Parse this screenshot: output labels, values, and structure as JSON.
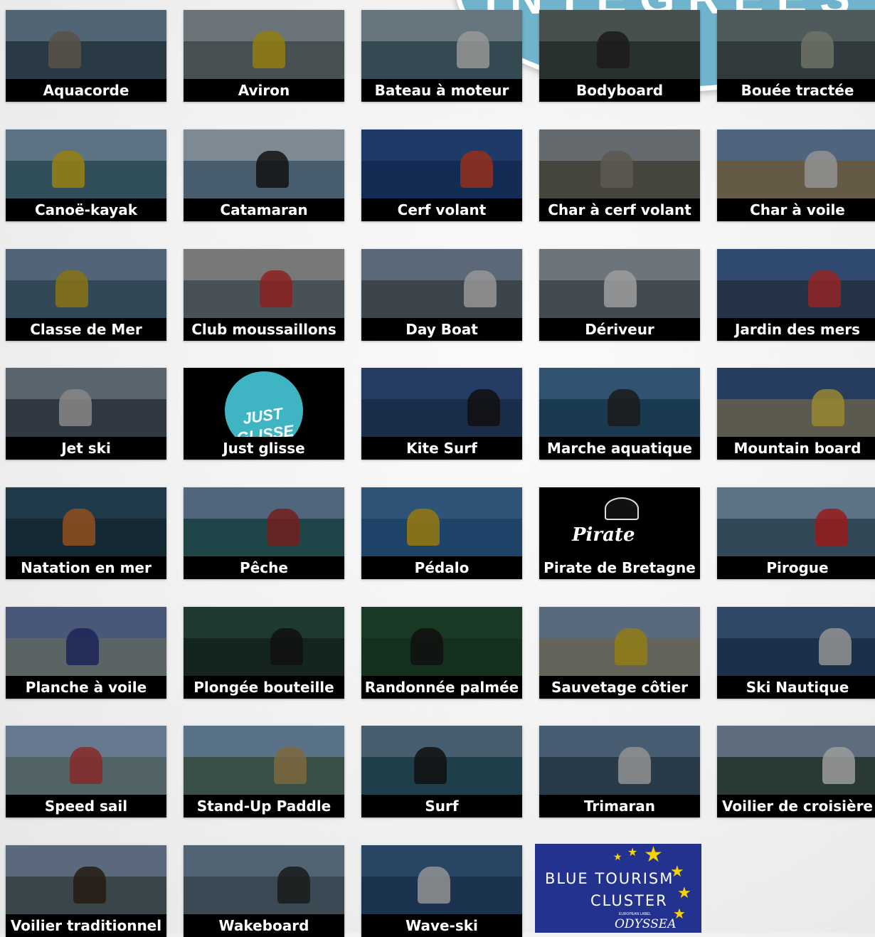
{
  "header": {
    "badge_text": "INTÉGRÉES"
  },
  "activities": [
    {
      "label": "Aquacorde",
      "sky": "#7f9bb3",
      "sea": "#3f5a6a",
      "accent": "#8a7f70"
    },
    {
      "label": "Aviron",
      "sky": "#a5b2b8",
      "sea": "#6d7c7f",
      "accent": "#e0c21a"
    },
    {
      "label": "Bateau à moteur",
      "sky": "#9fb4c4",
      "sea": "#51707f",
      "accent": "#e8e8e8"
    },
    {
      "label": "Bodyboard",
      "sky": "#6d7b79",
      "sea": "#3e4b4a",
      "accent": "#2a2a2a"
    },
    {
      "label": "Bouée tractée",
      "sky": "#7a8a8f",
      "sea": "#4c5b5f",
      "accent": "#aab2a0"
    },
    {
      "label": "Canoë-kayak",
      "sky": "#8fb0c8",
      "sea": "#4a7a8a",
      "accent": "#e6c51a"
    },
    {
      "label": "Catamaran",
      "sky": "#c0d4e4",
      "sea": "#6f8fa8",
      "accent": "#1c1c1c"
    },
    {
      "label": "Cerf volant",
      "sky": "#2f5aa0",
      "sea": "#1f4380",
      "accent": "#e44a2a"
    },
    {
      "label": "Char à cerf volant",
      "sky": "#9aa3aa",
      "sea": "#6b6a60",
      "accent": "#8c8a7e"
    },
    {
      "label": "Char à voile",
      "sky": "#7a9ac0",
      "sea": "#9a8a6a",
      "accent": "#e0e0e0"
    },
    {
      "label": "Classe de Mer",
      "sky": "#7f9cb8",
      "sea": "#4f6f84",
      "accent": "#d0b020"
    },
    {
      "label": "Club moussaillons",
      "sky": "#b8b8b8",
      "sea": "#6f7d84",
      "accent": "#d73030"
    },
    {
      "label": "Day Boat",
      "sky": "#8aa0b8",
      "sea": "#5b6a74",
      "accent": "#e6e6e6"
    },
    {
      "label": "Dériveur",
      "sky": "#a8b4bf",
      "sea": "#67737d",
      "accent": "#f0f0f0"
    },
    {
      "label": "Jardin des mers",
      "sky": "#4c72b0",
      "sea": "#3a4f70",
      "accent": "#e03a3a"
    },
    {
      "label": "Jet ski",
      "sky": "#8a9aa8",
      "sea": "#4a5864",
      "accent": "#cfcfcf"
    },
    {
      "label": "Just glisse",
      "sky": "#000000",
      "sea": "#000000",
      "accent": "#3fb5c4"
    },
    {
      "label": "Kite Surf",
      "sky": "#3a5f9a",
      "sea": "#284874",
      "accent": "#1a1a1a"
    },
    {
      "label": "Marche aquatique",
      "sky": "#4d7fb0",
      "sea": "#285a7f",
      "accent": "#2a2a2a"
    },
    {
      "label": "Mountain board",
      "sky": "#3c5f94",
      "sea": "#8e8a7a",
      "accent": "#e8d04a"
    },
    {
      "label": "Natation en mer",
      "sky": "#335a70",
      "sea": "#1f4050",
      "accent": "#e07a30"
    },
    {
      "label": "Pêche",
      "sky": "#7d9bbf",
      "sea": "#2f6a6f",
      "accent": "#b03030"
    },
    {
      "label": "Pédalo",
      "sky": "#4a80b8",
      "sea": "#2f68a0",
      "accent": "#e8b818"
    },
    {
      "label": "Pirate de Bretagne",
      "sky": "#000000",
      "sea": "#000000",
      "accent": "#ffffff"
    },
    {
      "label": "Pirogue",
      "sky": "#8fb0cc",
      "sea": "#4f6f84",
      "accent": "#e82a2a"
    },
    {
      "label": "Planche à voile",
      "sky": "#7088b8",
      "sea": "#8a9a9a",
      "accent": "#2a3a8a"
    },
    {
      "label": "Plongée bouteille",
      "sky": "#2f5a4a",
      "sea": "#1f3a32",
      "accent": "#1a1a1a"
    },
    {
      "label": "Randonnée palmée",
      "sky": "#2a5a3a",
      "sea": "#1f4a2f",
      "accent": "#1a1a1a"
    },
    {
      "label": "Sauvetage côtier",
      "sky": "#8aa4c0",
      "sea": "#9a9a8a",
      "accent": "#e0c020"
    },
    {
      "label": "Ski Nautique",
      "sky": "#4a6fa0",
      "sea": "#2a4a70",
      "accent": "#e0e0e0"
    },
    {
      "label": "Speed sail",
      "sky": "#9fbadb",
      "sea": "#7f9aa0",
      "accent": "#d04040"
    },
    {
      "label": "Stand-Up Paddle",
      "sky": "#8ab0cf",
      "sea": "#5a7a6a",
      "accent": "#c0a060"
    },
    {
      "label": "Surf",
      "sky": "#6f8fa8",
      "sea": "#2f6070",
      "accent": "#1a1a1a"
    },
    {
      "label": "Trimaran",
      "sky": "#6f8fb0",
      "sea": "#3f5a70",
      "accent": "#e0e0e0"
    },
    {
      "label": "Voilier de croisière",
      "sky": "#8fa8c0",
      "sea": "#3f5a50",
      "accent": "#f0f0f0"
    },
    {
      "label": "Voilier traditionnel",
      "sky": "#8aa4bf",
      "sea": "#5a6a70",
      "accent": "#3a2a1a"
    },
    {
      "label": "Wakeboard",
      "sky": "#7f9ab3",
      "sea": "#5a7080",
      "accent": "#2a2a2a"
    },
    {
      "label": "Wave-ski",
      "sky": "#3f6a9a",
      "sea": "#2a4f78",
      "accent": "#e0e0e0"
    }
  ],
  "logos": {
    "just_glisse": "JUST GLISSE",
    "pirate": "Pirate"
  },
  "blue_tourism": {
    "line1": "BLUE TOURISM",
    "line2": "CLUSTER",
    "small": "EUROPEAN LABEL",
    "brand": "ODYSSEA",
    "colors": {
      "background": "#23328f",
      "stars": "#f5d20a"
    }
  }
}
